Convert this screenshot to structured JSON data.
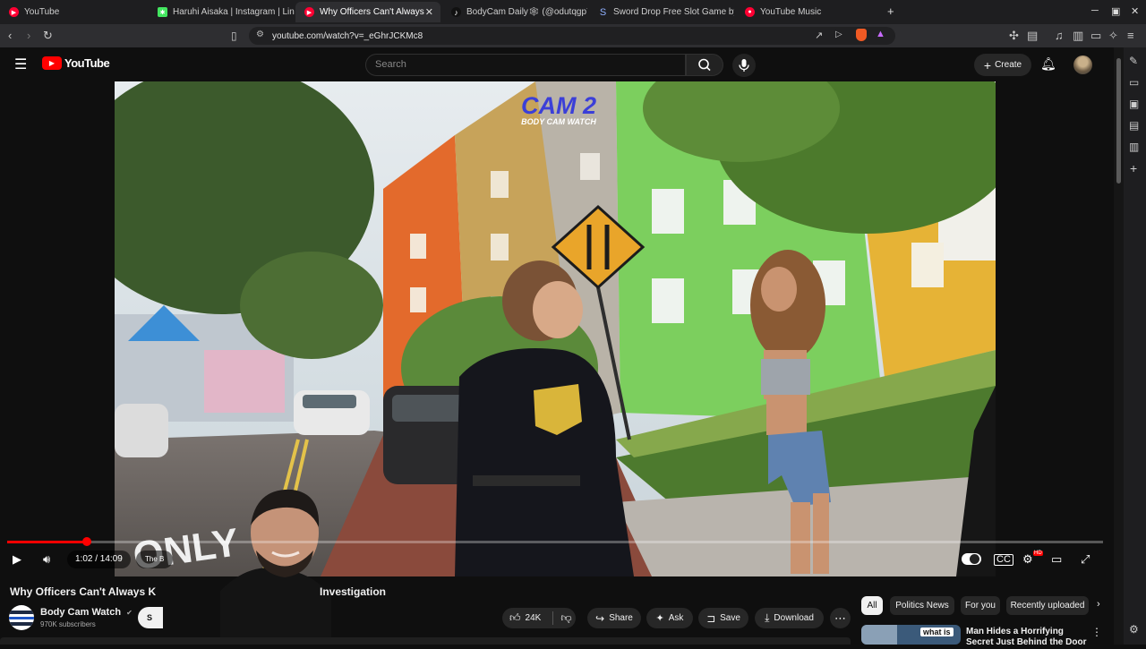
{
  "browser": {
    "tabs": [
      {
        "label": "YouTube",
        "icon": "youtube-icon",
        "color": "#ff0033"
      },
      {
        "label": "Haruhi Aisaka | Instagram | Lin",
        "icon": "linktree-icon",
        "color": "#43e660"
      },
      {
        "label": "Why Officers Can't Always K",
        "icon": "youtube-icon",
        "color": "#ff0033",
        "active": true
      },
      {
        "label": "BodyCam Daily🕸 (@odutqgp71",
        "icon": "tiktok-icon",
        "color": "#111111"
      },
      {
        "label": "Sword Drop Free Slot Game by",
        "icon": "slot-icon",
        "color": "#5577cc"
      },
      {
        "label": "YouTube Music",
        "icon": "youtube-music-icon",
        "color": "#ff0033"
      }
    ],
    "new_tab": "+",
    "url": "youtube.com/watch?v=_eGhrJCKMc8"
  },
  "youtube": {
    "logo_text": "YouTube",
    "search_placeholder": "Search",
    "create_label": "Create"
  },
  "video": {
    "watermark_top": "CAM 2",
    "watermark_bottom": "BODY CAM WATCH",
    "road_text": "ONLY",
    "current_time": "1:02",
    "duration": "14:09",
    "time_display": "1:02 / 14:09",
    "progress_fraction": 0.0731,
    "chapter_label": "The B",
    "settings_badge": "HD"
  },
  "details": {
    "title_visible_left": "Why Officers Can't Always K",
    "title_visible_right": "Investigation",
    "channel_name": "Body Cam Watch",
    "verified_icon": "verified-icon",
    "subscribers": "970K subscribers",
    "subscribe_label": "S",
    "likes": "24K",
    "share_label": "Share",
    "ask_label": "Ask",
    "save_label": "Save",
    "download_label": "Download"
  },
  "sidebar": {
    "chips": [
      {
        "label": "All",
        "selected": true
      },
      {
        "label": "Politics News",
        "selected": false
      },
      {
        "label": "For you",
        "selected": false
      },
      {
        "label": "Recently uploaded",
        "selected": false
      }
    ],
    "recommendation": {
      "title": "Man Hides a Horrifying Secret Just Behind the Door",
      "thumb_text": "what is"
    }
  },
  "colors": {
    "accent": "#ff0000",
    "background": "#0f0f0f",
    "pill": "#272727"
  }
}
